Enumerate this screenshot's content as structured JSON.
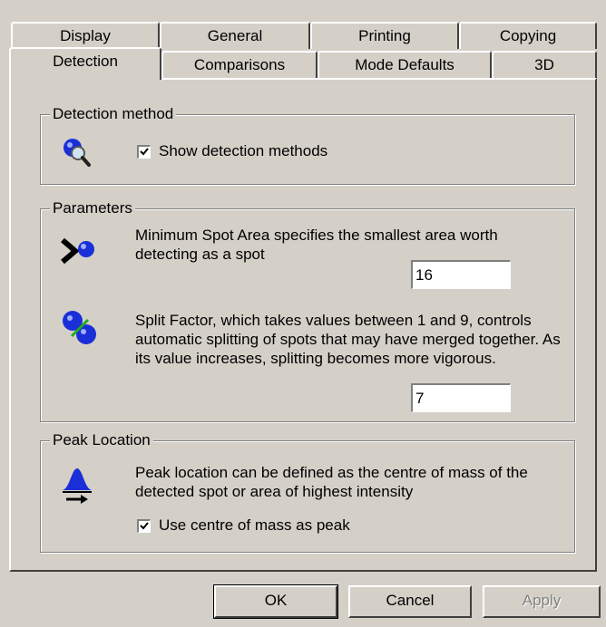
{
  "tabs": {
    "back_row": [
      "Display",
      "General",
      "Printing",
      "Copying"
    ],
    "front_row": [
      "Detection",
      "Comparisons",
      "Mode Defaults",
      "3D"
    ],
    "active": "Detection"
  },
  "detection_method": {
    "title": "Detection method",
    "show_methods_label": "Show detection methods",
    "show_methods_checked": true
  },
  "parameters": {
    "title": "Parameters",
    "min_spot_text": "Minimum Spot Area specifies the smallest area worth detecting as a spot",
    "min_spot_value": "16",
    "split_text": "Split Factor, which takes values between 1 and 9, controls automatic splitting of spots that may have merged together.  As its value increases, splitting becomes more vigorous.",
    "split_value": "7"
  },
  "peak": {
    "title": "Peak Location",
    "text": "Peak location can be defined as the centre of mass of the detected spot or area of highest intensity",
    "centre_label": "Use centre of mass as peak",
    "centre_checked": true
  },
  "buttons": {
    "ok": "OK",
    "cancel": "Cancel",
    "apply": "Apply"
  },
  "icons": {
    "detection": "magnifier-spot-icon",
    "min_spot": "arrow-spot-icon",
    "split": "split-spots-icon",
    "peak": "peak-icon"
  }
}
